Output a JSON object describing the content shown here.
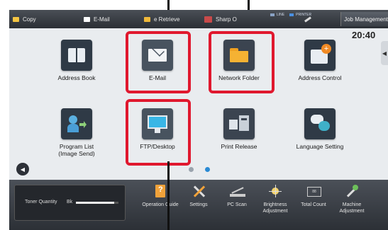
{
  "topbar": {
    "items": [
      {
        "label": "Copy",
        "color": "#f5c542"
      },
      {
        "label": "E-Mail",
        "color": "#ffffff"
      },
      {
        "label": "e Retrieve",
        "color": "#f0b93a"
      },
      {
        "label": "Sharp O",
        "color": "#c84a4a"
      }
    ],
    "status_line": "LINE",
    "status_printer": "PRINTER",
    "job_management": "Job Management",
    "clock": "20:40"
  },
  "tiles": [
    {
      "label": "Address Book",
      "icon": "address-book-icon",
      "color": "#2f3a46"
    },
    {
      "label": "E-Mail",
      "icon": "envelope-icon",
      "color": "#48535f"
    },
    {
      "label": "Network Folder",
      "icon": "folder-icon",
      "color": "#3b4450"
    },
    {
      "label": "Address Control",
      "icon": "address-control-icon",
      "color": "#2f3a46"
    },
    {
      "label": "Program List (Image Send)",
      "icon": "program-list-icon",
      "color": "#2f3a46"
    },
    {
      "label": "FTP/Desktop",
      "icon": "monitor-icon",
      "color": "#48535f"
    },
    {
      "label": "Print Release",
      "icon": "print-release-icon",
      "color": "#3b4450"
    },
    {
      "label": "Language Setting",
      "icon": "language-icon",
      "color": "#2f3a46"
    }
  ],
  "highlight_color": "#e0182e",
  "bottombar": {
    "toner_label": "Toner Quantity",
    "toner_color": "Bk",
    "toner_level": 0.9,
    "items": [
      {
        "label": "Operation Guide",
        "icon": "operation-guide-icon"
      },
      {
        "label": "Settings",
        "icon": "settings-icon"
      },
      {
        "label": "PC Scan",
        "icon": "pc-scan-icon"
      },
      {
        "label": "Brightness Adjustment",
        "icon": "brightness-icon"
      },
      {
        "label": "Total Count",
        "icon": "total-count-icon"
      },
      {
        "label": "Machine Adjustment",
        "icon": "machine-adjustment-icon"
      }
    ]
  }
}
